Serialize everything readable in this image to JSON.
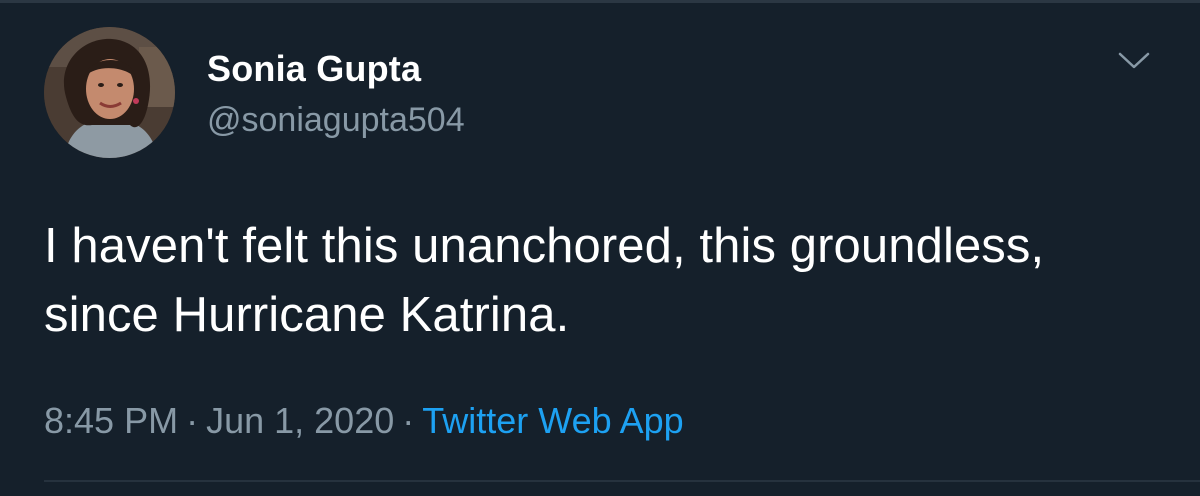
{
  "tweet": {
    "author": {
      "display_name": "Sonia Gupta",
      "handle": "@soniagupta504"
    },
    "text": "I haven't felt this unanchored, this groundless, since Hurricane Katrina.",
    "time": "8:45 PM",
    "separator": "·",
    "date": "Jun 1, 2020",
    "source": "Twitter Web App",
    "menu_icon": "chevron-down-icon"
  },
  "colors": {
    "background": "#15202b",
    "primary_text": "#ffffff",
    "secondary_text": "#8899a6",
    "link": "#1da1f2"
  }
}
